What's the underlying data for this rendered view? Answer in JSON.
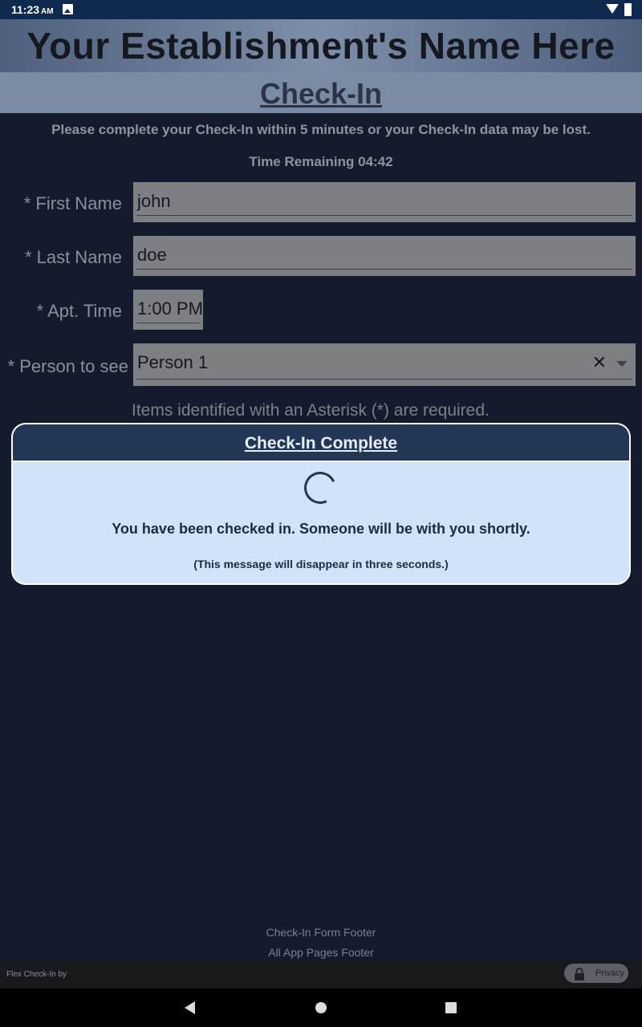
{
  "status": {
    "time": "11:23",
    "ampm": "AM"
  },
  "header": {
    "establishment": "Your Establishment's Name Here",
    "title": "Check-In"
  },
  "instructions": "Please complete your Check-In within 5 minutes or your Check-In data may be lost.",
  "timer": "Time Remaining 04:42",
  "form": {
    "first_name": {
      "label": "*  First Name",
      "value": "john"
    },
    "last_name": {
      "label": "*  Last Name",
      "value": "doe"
    },
    "apt_time": {
      "label": "*  Apt. Time",
      "value": "1:00 PM"
    },
    "person": {
      "label": "*  Person to see",
      "value": "Person 1",
      "clear": "✕"
    },
    "required_note": "Items identified with an Asterisk (*) are required."
  },
  "modal": {
    "title": "Check-In Complete",
    "message": "You have been checked in.  Someone will be with you shortly.",
    "sub": "(This message will disappear in three seconds.)"
  },
  "footer": {
    "form_footer": "Check-In Form Footer",
    "app_footer": "All App Pages Footer",
    "brand": "Flex Check-In by",
    "privacy": "Privacy"
  }
}
